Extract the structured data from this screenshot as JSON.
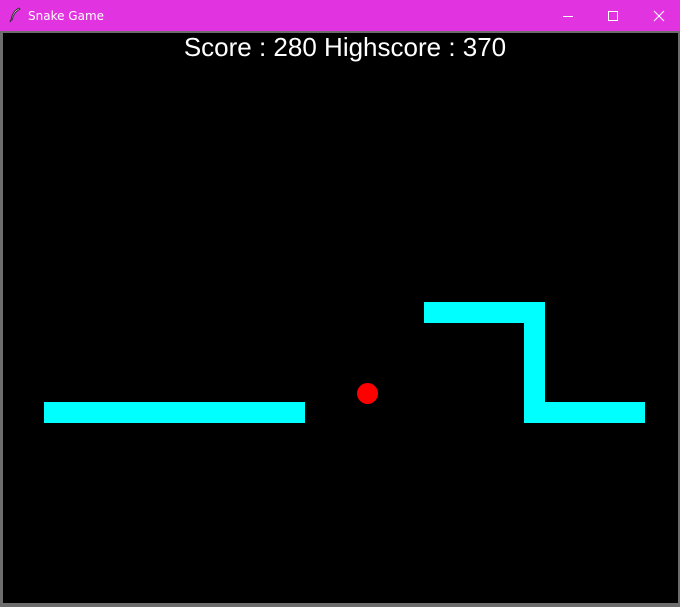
{
  "window": {
    "title": "Snake Game",
    "titlebar_color": "#e233e0",
    "controls": {
      "minimize_icon": "minimize-icon",
      "maximize_icon": "maximize-icon",
      "close_icon": "close-icon"
    }
  },
  "game": {
    "background_color": "#000000",
    "score_text": "Score : 280 Highscore : 370",
    "score": 280,
    "highscore": 370,
    "snake_color": "#00ffff",
    "food_color": "#ff0000"
  }
}
